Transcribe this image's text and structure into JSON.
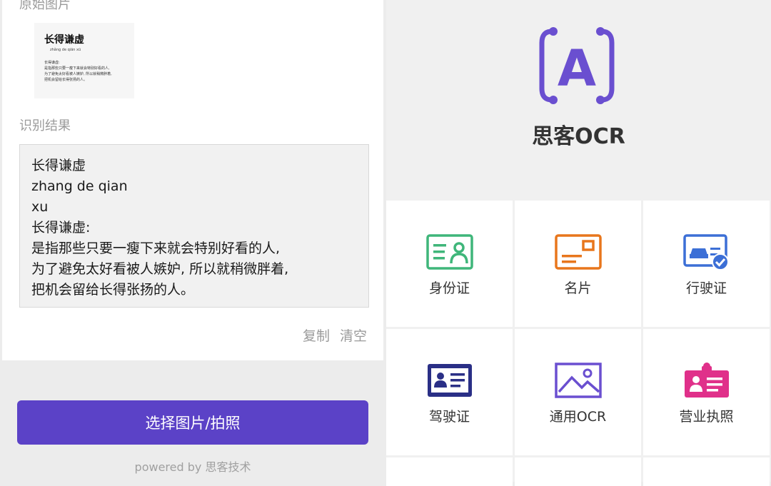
{
  "left_screen": {
    "original_label": "原始图片",
    "thumbnail": {
      "title": "长得谦虚",
      "pinyin": "zhǎng de qiān xū",
      "body": "长得谦虚:\n是指那些只要一瘦下来就会特别好看的人,\n为了避免太好看被人嫉妒, 所以就稍微胖着,\n把机会留给长得张扬的人。"
    },
    "result_label": "识别结果",
    "result_text": "长得谦虚\nzhang de qian\nxu\n长得谦虚:\n是指那些只要一瘦下来就会特别好看的人,\n为了避免太好看被人嫉妒, 所以就稍微胖着,\n把机会留给长得张扬的人。",
    "copy_label": "复制",
    "clear_label": "清空",
    "select_button": "选择图片/拍照",
    "powered_by": "powered by 思客技术"
  },
  "right_screen": {
    "app_name": "思客OCR",
    "logo_letter": "A",
    "menu": [
      {
        "label": "身份证",
        "icon": "id-card-icon",
        "color": "#3fb67a"
      },
      {
        "label": "名片",
        "icon": "business-card-icon",
        "color": "#e8761c"
      },
      {
        "label": "行驶证",
        "icon": "vehicle-license-icon",
        "color": "#3c6fd6"
      },
      {
        "label": "驾驶证",
        "icon": "driver-license-icon",
        "color": "#2a2f86"
      },
      {
        "label": "通用OCR",
        "icon": "image-icon",
        "color": "#6a4fd0"
      },
      {
        "label": "营业执照",
        "icon": "business-license-icon",
        "color": "#e0308a"
      }
    ]
  },
  "colors": {
    "accent": "#5b42c7",
    "logo": "#6a4fd0"
  }
}
